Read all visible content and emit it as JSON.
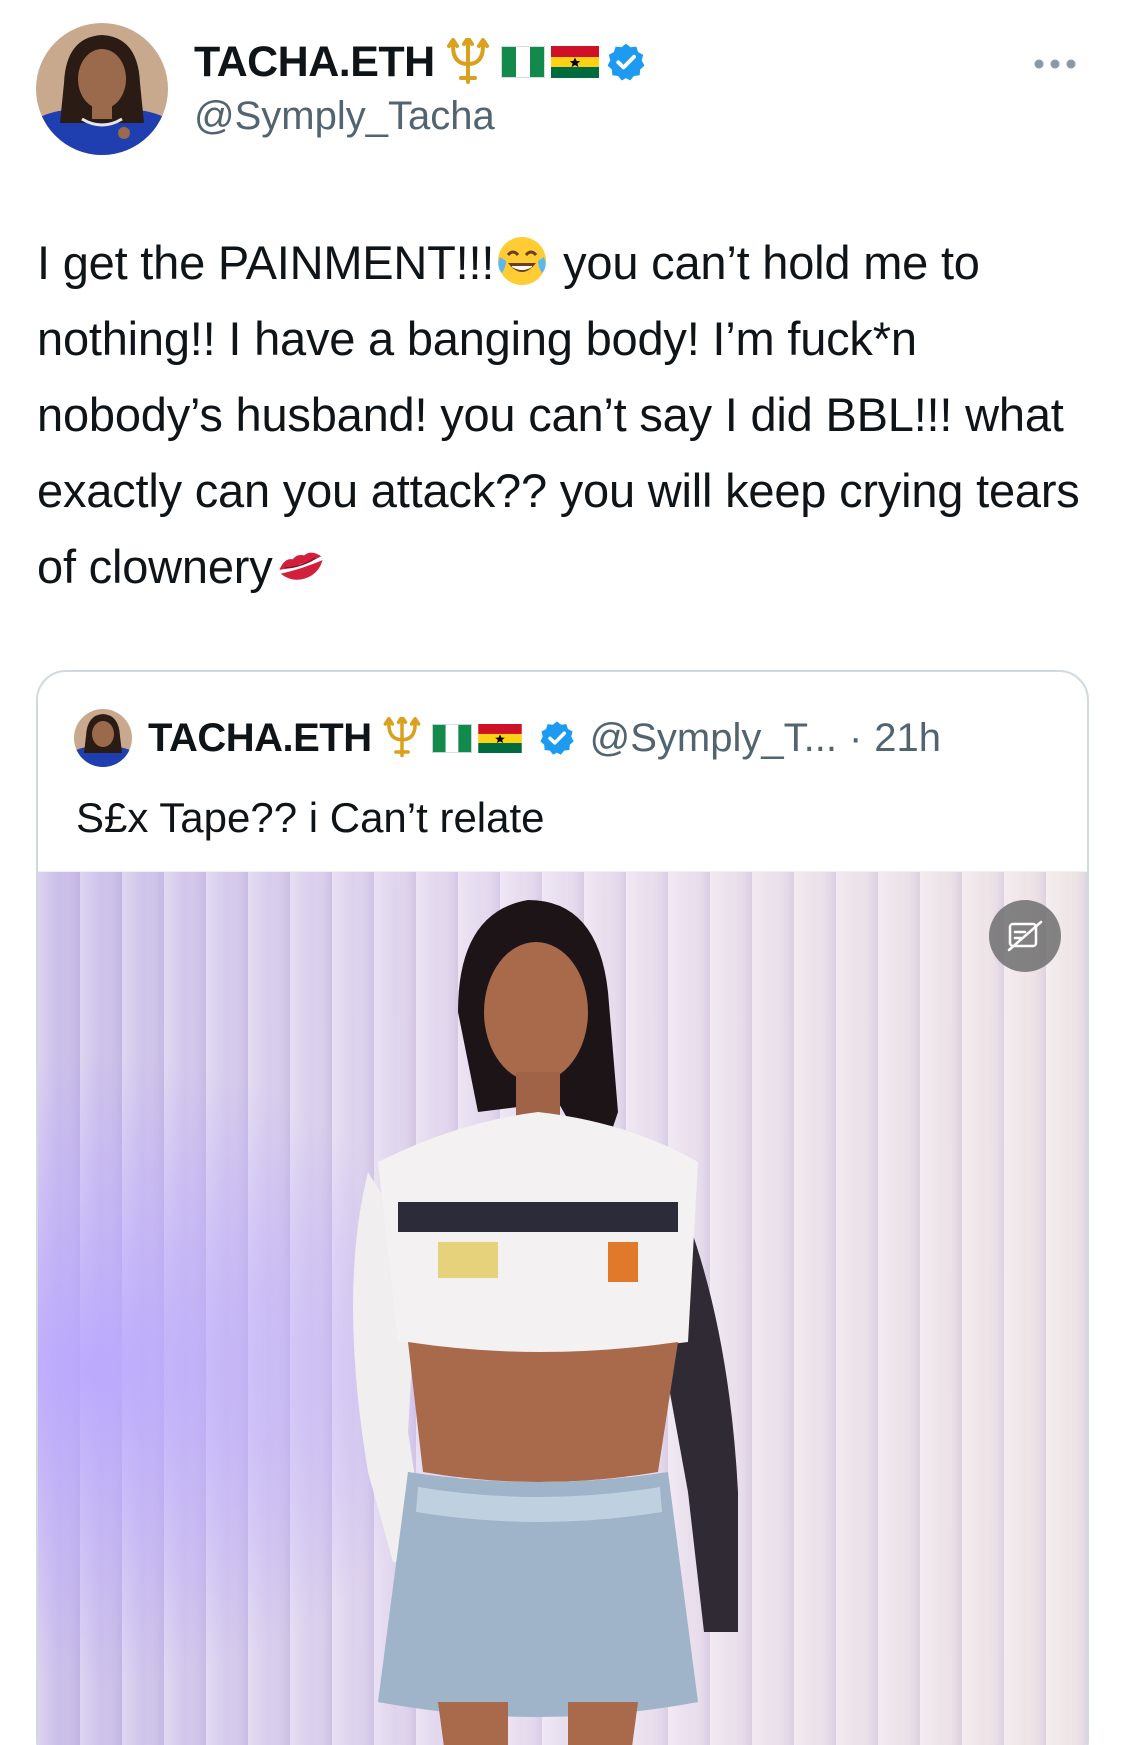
{
  "tweet": {
    "author": {
      "display_name": "TACHA.ETH",
      "handle": "@Symply_Tacha",
      "badges": [
        "trident-emoji",
        "nigeria-flag",
        "ghana-flag",
        "verified-badge"
      ]
    },
    "text_parts": {
      "p1": "I get the PAINMENT!!!",
      "emoji1": "face-with-tears-of-joy-emoji",
      "p2": " you can’t hold me to nothing!! I have a banging body! I’m fuck*n nobody’s husband! you can’t say I did BBL!!! what exactly can you attack?? you will keep crying tears of clownery",
      "emoji2": "kiss-mark-emoji"
    },
    "more_icon": "more-horizontal-icon"
  },
  "quoted_tweet": {
    "author": {
      "display_name": "TACHA.ETH",
      "handle": "@Symply_T...",
      "time": "21h",
      "separator": "·"
    },
    "text": "S£x Tape?? i Can’t relate",
    "media_icon": "content-warning-icon"
  },
  "colors": {
    "text_primary": "#0f1419",
    "text_secondary": "#536471",
    "verified_blue": "#1d9bf0",
    "border": "#cfd9de"
  }
}
